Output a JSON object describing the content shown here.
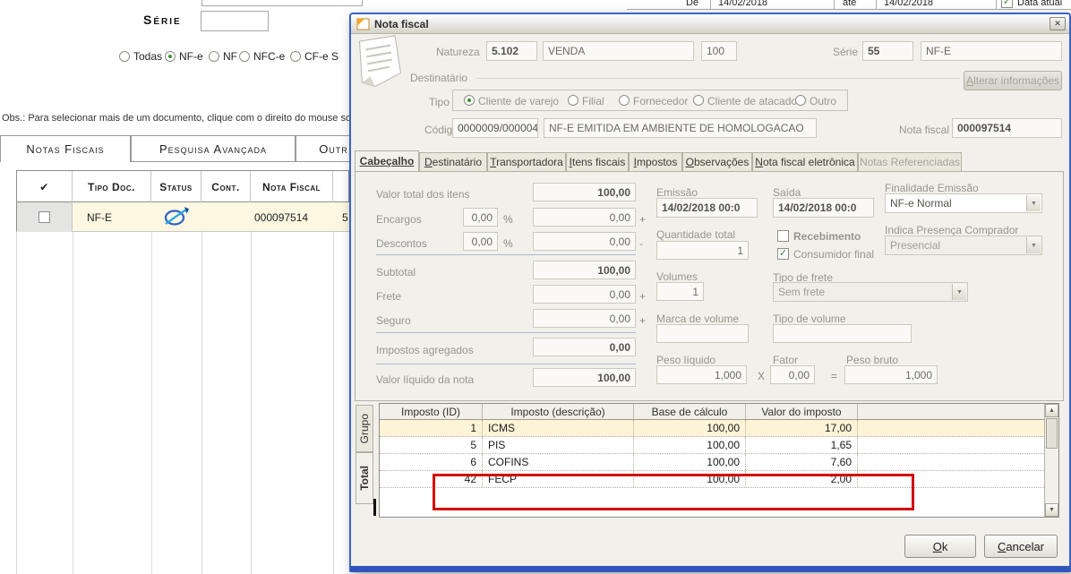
{
  "icons": {
    "close": "✕",
    "dropdown": "▼",
    "scroll_up": "▲",
    "scroll_down": "▼",
    "check": "✓",
    "checkmark_header": "✔"
  },
  "colors": {
    "dialog_border": "#3a63c4",
    "annotation_red": "#d40b00",
    "table_row_highlight": "#fdf3d6",
    "grid_row_bg": "#fbf7e1",
    "radio_dot": "#3e8e2f"
  },
  "background": {
    "serie_label": "Série",
    "filter": {
      "options": [
        {
          "label": "Todas",
          "selected": false
        },
        {
          "label": "NF-e",
          "selected": true
        },
        {
          "label": "NF",
          "selected": false
        },
        {
          "label": "NFC-e",
          "selected": false
        },
        {
          "label": "CF-e S",
          "selected": false
        }
      ]
    },
    "obs": "Obs.: Para selecionar mais de um documento, clique com o direito do mouse sobre",
    "tabs": [
      {
        "label": "Notas Fiscais"
      },
      {
        "label": "Pesquisa Avançada"
      },
      {
        "label": "Outr"
      }
    ],
    "grid": {
      "headers": [
        "✔",
        "Tipo Doc.",
        "Status",
        "Cont.",
        "Nota Fiscal"
      ],
      "row": {
        "tipo_doc": "NF-E",
        "nota_fiscal": "000097514",
        "serie": "5"
      }
    },
    "dates": {
      "de_label": "De",
      "de": "14/02/2018",
      "ate_label": "até",
      "ate": "14/02/2018",
      "data_atual": "Data atual"
    }
  },
  "dialog": {
    "title": "Nota fiscal",
    "natureza": {
      "label": "Natureza",
      "codigo": "5.102",
      "descricao": "VENDA",
      "numero": "100"
    },
    "serie": {
      "label": "Série",
      "valor": "55",
      "tipo": "NF-E"
    },
    "destinatario": {
      "group": "Destinatário",
      "tipo_label": "Tipo",
      "tipos": [
        {
          "label": "Cliente de varejo",
          "selected": true
        },
        {
          "label": "Filial",
          "selected": false
        },
        {
          "label": "Fornecedor",
          "selected": false
        },
        {
          "label": "Cliente de atacado",
          "selected": false
        },
        {
          "label": "Outro",
          "selected": false
        }
      ],
      "alterar": "Alterar informações",
      "codigo_label": "Código",
      "codigo": "0000009/000004",
      "nome": "NF-E EMITIDA EM AMBIENTE DE HOMOLOGACAO",
      "nota_label": "Nota fiscal",
      "nota": "000097514"
    },
    "tabs": [
      {
        "label": "Cabeçalho",
        "active": true
      },
      {
        "label": "Destinatário"
      },
      {
        "label": "Transportadora"
      },
      {
        "label": "Itens fiscais"
      },
      {
        "label": "Impostos"
      },
      {
        "label": "Observações"
      },
      {
        "label": "Nota fiscal eletrônica"
      },
      {
        "label": "Notas Referenciadas",
        "disabled": true
      }
    ],
    "cabecalho": {
      "valor_total_label": "Valor total dos itens",
      "valor_total": "100,00",
      "encargos_label": "Encargos",
      "encargos_pct": "0,00",
      "encargos": "0,00",
      "descontos_label": "Descontos",
      "descontos_pct": "0,00",
      "descontos": "0,00",
      "pct": "%",
      "mais": "+",
      "menos": "-",
      "subtotal_label": "Subtotal",
      "subtotal": "100,00",
      "frete_label": "Frete",
      "frete": "0,00",
      "seguro_label": "Seguro",
      "seguro": "0,00",
      "impostos_label": "Impostos agregados",
      "impostos": "0,00",
      "liquido_label": "Valor líquido da nota",
      "liquido": "100,00",
      "emissao_label": "Emissão",
      "emissao": "14/02/2018 00:0",
      "saida_label": "Saída",
      "saida": "14/02/2018 00:0",
      "finalidade_label": "Finalidade Emissão",
      "finalidade": "NF-e Normal",
      "quantidade_label": "Quantidade total",
      "quantidade": "1",
      "recebimento_label": "Recebimento",
      "consumidor_label": "Consumidor final",
      "presenca_label": "Indica Presença Comprador",
      "presenca": "Presencial",
      "volumes_label": "Volumes",
      "volumes": "1",
      "frete_tipo_label": "Tipo de frete",
      "frete_tipo": "Sem frete",
      "marca_label": "Marca de volume",
      "volume_tipo_label": "Tipo de volume",
      "peso_liquido_label": "Peso líquido",
      "peso_liquido": "1,000",
      "x": "X",
      "fator_label": "Fator",
      "fator": "0,00",
      "igual": "=",
      "peso_bruto_label": "Peso bruto",
      "peso_bruto": "1,000"
    },
    "impostos": {
      "side_tabs": [
        {
          "label": "Grupo",
          "active": false
        },
        {
          "label": "Total",
          "active": true
        }
      ],
      "headers": [
        "Imposto (ID)",
        "Imposto (descrição)",
        "Base de cálculo",
        "Valor do imposto"
      ],
      "rows": [
        {
          "id": "1",
          "descricao": "ICMS",
          "base": "100,00",
          "valor": "17,00"
        },
        {
          "id": "5",
          "descricao": "PIS",
          "base": "100,00",
          "valor": "1,65"
        },
        {
          "id": "6",
          "descricao": "COFINS",
          "base": "100,00",
          "valor": "7,60"
        },
        {
          "id": "42",
          "descricao": "FECP",
          "base": "100,00",
          "valor": "2,00"
        }
      ]
    },
    "buttons": {
      "ok": "Ok",
      "cancelar": "Cancelar"
    }
  }
}
